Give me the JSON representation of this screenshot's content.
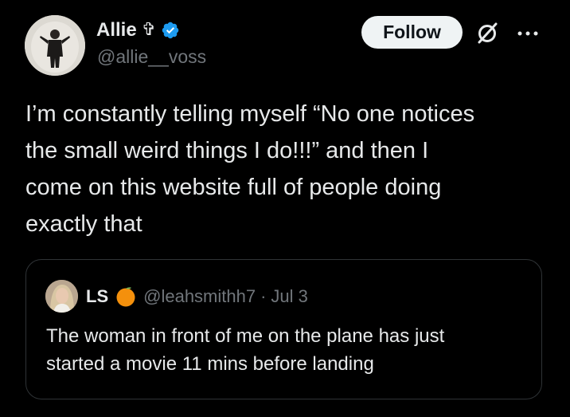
{
  "author": {
    "display_name": "Allie",
    "name_emoji": "✞",
    "verified": true,
    "verified_color": "#1d9bf0",
    "handle": "@allie__voss",
    "avatar_icon": "profile-photo"
  },
  "actions": {
    "follow_label": "Follow",
    "grok_icon": "grok-icon",
    "more_icon": "more-horizontal-icon"
  },
  "tweet": {
    "text": "I’m constantly telling myself “No one notices\nthe small weird things I do!!!” and then I\ncome on this website full of people doing\nexactly that"
  },
  "quote": {
    "display_name": "LS",
    "name_emoji": "orange-icon",
    "handle": "@leahsmithh7",
    "separator": "·",
    "date": "Jul 3",
    "text": "The woman in front of me on the plane has just\nstarted a movie 11 mins before landing",
    "avatar_icon": "profile-photo"
  },
  "colors": {
    "background": "#000000",
    "text_primary": "#e7e9ea",
    "text_secondary": "#71767b",
    "border": "#2f3336",
    "follow_bg": "#eff3f4",
    "follow_text": "#0f1419",
    "verified": "#1d9bf0",
    "orange": "#f4900c"
  }
}
